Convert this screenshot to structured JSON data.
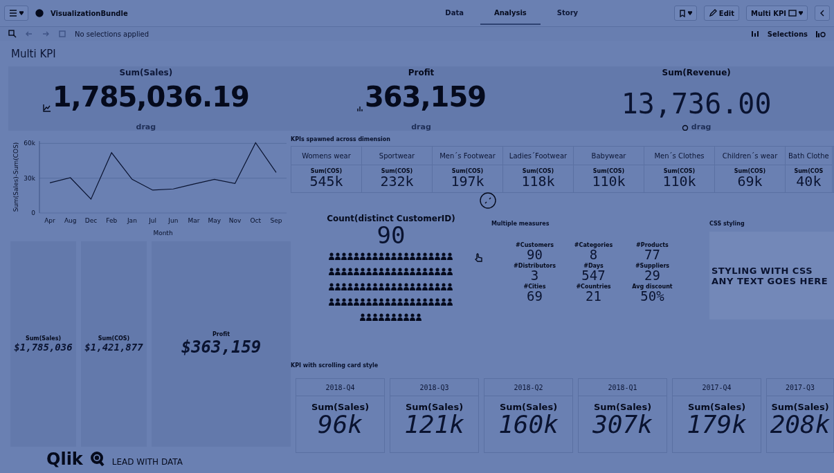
{
  "header": {
    "app_name": "VisualizationBundle",
    "tabs": [
      {
        "label": "Data",
        "selected": false
      },
      {
        "label": "Analysis",
        "selected": true
      },
      {
        "label": "Story",
        "selected": false
      }
    ],
    "edit_label": "Edit",
    "sheet_label": "Multi KPI"
  },
  "selection_bar": {
    "status": "No selections applied",
    "selections_label": "Selections"
  },
  "sheet_title": "Multi KPI",
  "top_kpis": [
    {
      "kind": "trend",
      "label": "Sum(Sales)",
      "value": "1,785,036.19",
      "footer": "drag"
    },
    {
      "kind": "bars",
      "label": "Profit",
      "value": "363,159",
      "footer": "drag"
    },
    {
      "kind": "mono",
      "label": "Sum(Revenue)",
      "value": "13,736.00",
      "footer": "drag"
    }
  ],
  "line_chart": {
    "chart_data": {
      "type": "line",
      "xlabel": "Month",
      "ylabel": "Sum(Sales)-Sum(COS)",
      "categories": [
        "Apr",
        "Aug",
        "Dec",
        "Feb",
        "Jan",
        "Jul",
        "Jun",
        "Mar",
        "May",
        "Nov",
        "Oct",
        "Sep"
      ],
      "series": [
        {
          "color": "#0a1330",
          "values": [
            26000,
            30400,
            12000,
            52000,
            29000,
            19700,
            20700,
            25000,
            29000,
            25500,
            60500,
            35000
          ]
        }
      ],
      "ylim": [
        0,
        62000
      ],
      "yticks": [
        {
          "value": 0,
          "label": "0"
        },
        {
          "value": 30000,
          "label": "30k"
        },
        {
          "value": 60000,
          "label": "60k"
        }
      ]
    }
  },
  "treemap": [
    {
      "label": "Sum(Sales)",
      "value": "$1,785,036"
    },
    {
      "label": "Sum(COS)",
      "value": "$1,421,877"
    },
    {
      "label": "Profit",
      "value": "$363,159"
    }
  ],
  "dimension_kpis": {
    "title": "KPIs spawned across dimension",
    "items": [
      {
        "dimension": "Womens wear",
        "label": "Sum(COS)",
        "value": "545k"
      },
      {
        "dimension": "Sportwear",
        "label": "Sum(COS)",
        "value": "232k"
      },
      {
        "dimension": "Men´s Footwear",
        "label": "Sum(COS)",
        "value": "197k"
      },
      {
        "dimension": "Ladies´Footwear",
        "label": "Sum(COS)",
        "value": "118k"
      },
      {
        "dimension": "Babywear",
        "label": "Sum(COS)",
        "value": "110k"
      },
      {
        "dimension": "Men´s Clothes",
        "label": "Sum(COS)",
        "value": "110k"
      },
      {
        "dimension": "Children´s wear",
        "label": "Sum(COS)",
        "value": "69k"
      },
      {
        "dimension": "Bath Clothe",
        "label": "Sum(COS",
        "value": "40k"
      }
    ]
  },
  "count_kpi": {
    "label": "Count(distinct CustomerID)",
    "value": "90"
  },
  "multiple_measures": {
    "title": "Multiple measures",
    "items": [
      {
        "label": "#Customers",
        "value": "90"
      },
      {
        "label": "#Categories",
        "value": "8"
      },
      {
        "label": "#Products",
        "value": "77"
      },
      {
        "label": "#Distributors",
        "value": "3"
      },
      {
        "label": "#Days",
        "value": "547"
      },
      {
        "label": "#Suppliers",
        "value": "29"
      },
      {
        "label": "#Cities",
        "value": "69"
      },
      {
        "label": "#Countries",
        "value": "21"
      },
      {
        "label": "Avg discount",
        "value": "50%"
      }
    ]
  },
  "css_styling": {
    "title": "CSS styling",
    "lines": [
      "STYLING WITH CSS",
      "ANY TEXT GOES HERE"
    ]
  },
  "scrolling_cards": {
    "title": "KPI with scrolling card style",
    "cards": [
      {
        "period": "2018-Q4",
        "label": "Sum(Sales)",
        "value": "96k"
      },
      {
        "period": "2018-Q3",
        "label": "Sum(Sales)",
        "value": "121k"
      },
      {
        "period": "2018-Q2",
        "label": "Sum(Sales)",
        "value": "160k"
      },
      {
        "period": "2018-Q1",
        "label": "Sum(Sales)",
        "value": "307k"
      },
      {
        "period": "2017-Q4",
        "label": "Sum(Sales)",
        "value": "179k"
      },
      {
        "period": "2017-Q3",
        "label": "Sum(Sales)",
        "value": "208k"
      }
    ]
  },
  "footer": {
    "logo": "Qlik",
    "tagline": "LEAD WITH DATA"
  }
}
